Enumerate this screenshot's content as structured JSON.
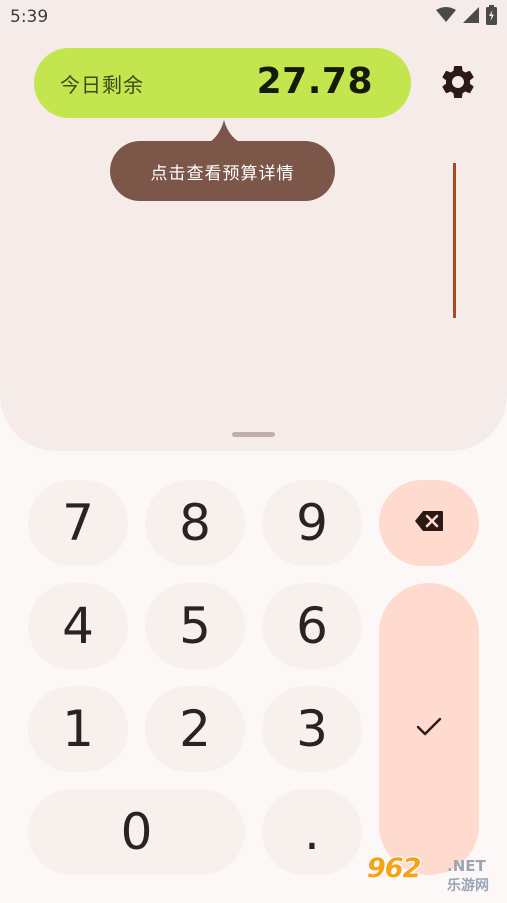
{
  "status_bar": {
    "time": "5:39",
    "icons": [
      "wifi-icon",
      "cell-signal-icon",
      "battery-charging-icon"
    ]
  },
  "budget": {
    "label": "今日剩余",
    "value": "27.78"
  },
  "tooltip": {
    "text": "点击查看预算详情"
  },
  "keypad": {
    "keys": {
      "k7": "7",
      "k8": "8",
      "k9": "9",
      "k4": "4",
      "k5": "5",
      "k6": "6",
      "k1": "1",
      "k2": "2",
      "k3": "3",
      "k0": "0",
      "dot": "."
    },
    "delete_icon": "backspace-icon",
    "confirm_icon": "check-icon"
  },
  "watermark": {
    "logo": "962",
    "net": ".NET",
    "site": "乐游网"
  },
  "colors": {
    "budget_pill": "#c3e54e",
    "tooltip": "#7c5649",
    "action_keys": "#ffdacf",
    "digit_keys": "#f8f0ec",
    "cursor": "#a94a1c"
  }
}
